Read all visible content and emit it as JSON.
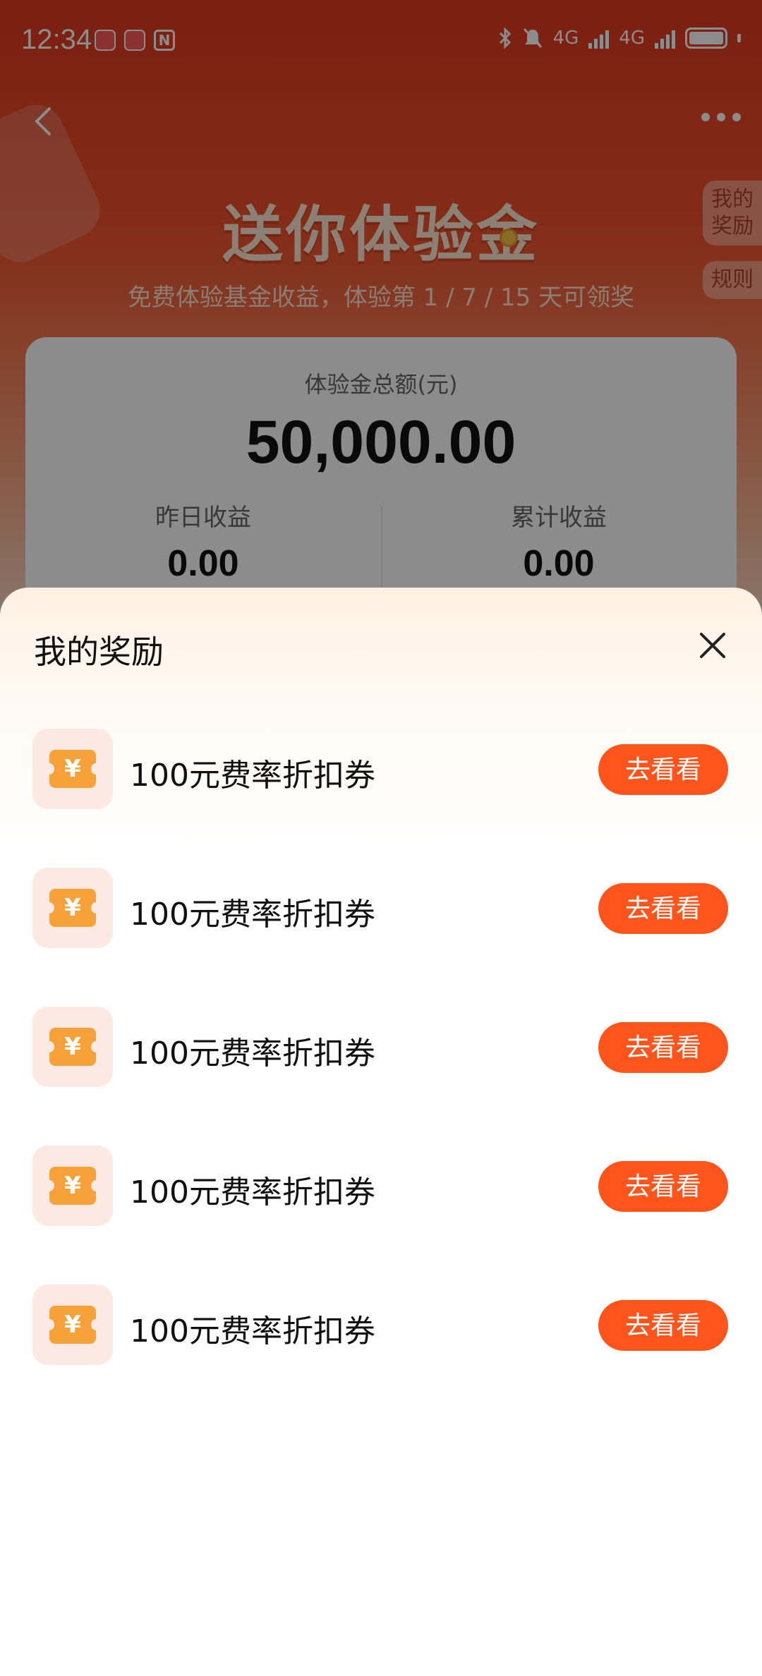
{
  "status_bar": {
    "time": "12:34",
    "network": "4G"
  },
  "page": {
    "hero_title": "送你体验金",
    "hero_subtitle": "免费体验基金收益，体验第 1 / 7 / 15 天可领奖",
    "side_tabs": {
      "my_rewards": "我的\n奖励",
      "rules": "规则"
    },
    "summary": {
      "total_label": "体验金总额(元)",
      "total_amount": "50,000.00",
      "yesterday_label": "昨日收益",
      "yesterday_value": "0.00",
      "cumulative_label": "累计收益",
      "cumulative_value": "0.00"
    }
  },
  "sheet": {
    "title": "我的奖励",
    "items": [
      {
        "icon": "coupon-yen-icon",
        "symbol": "¥",
        "name": "100元费率折扣券",
        "button": "去看看"
      },
      {
        "icon": "coupon-yen-icon",
        "symbol": "¥",
        "name": "100元费率折扣券",
        "button": "去看看"
      },
      {
        "icon": "coupon-yen-icon",
        "symbol": "¥",
        "name": "100元费率折扣券",
        "button": "去看看"
      },
      {
        "icon": "coupon-yen-icon",
        "symbol": "¥",
        "name": "100元费率折扣券",
        "button": "去看看"
      },
      {
        "icon": "coupon-yen-icon",
        "symbol": "¥",
        "name": "100元费率折扣券",
        "button": "去看看"
      }
    ]
  },
  "colors": {
    "accent": "#ff541c",
    "coupon": "#f7a13a",
    "coupon_bg": "#fde9e4",
    "hero_bg": "#e0391f"
  }
}
